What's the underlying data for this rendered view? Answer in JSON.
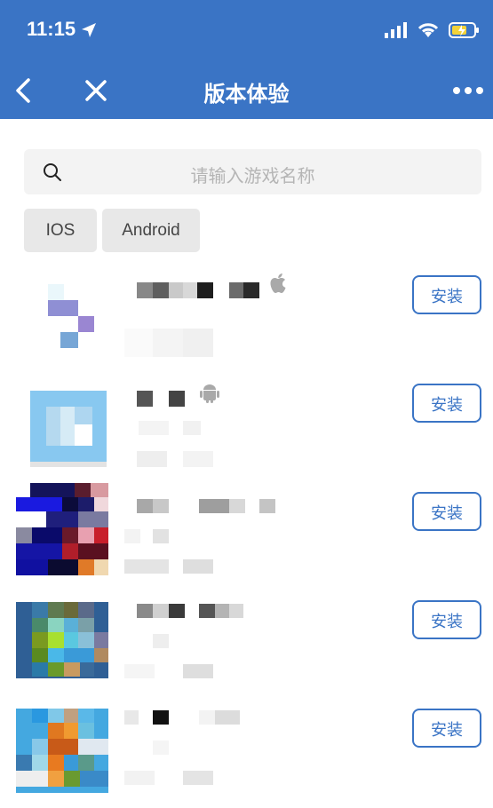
{
  "status": {
    "time": "11:15"
  },
  "nav": {
    "title": "版本体验"
  },
  "search": {
    "placeholder": "请输入游戏名称"
  },
  "filters": [
    {
      "label": "IOS"
    },
    {
      "label": "Android"
    }
  ],
  "apps": [
    {
      "platform": "apple-icon",
      "install_label": "安装"
    },
    {
      "platform": "android-icon",
      "install_label": "安装"
    },
    {
      "platform": "",
      "install_label": "安装"
    },
    {
      "platform": "",
      "install_label": "安装"
    },
    {
      "platform": "",
      "install_label": "安装"
    }
  ],
  "colors": {
    "primary": "#3a74c5",
    "search_bg": "#f3f3f3",
    "chip_bg": "#e8e8e8"
  }
}
